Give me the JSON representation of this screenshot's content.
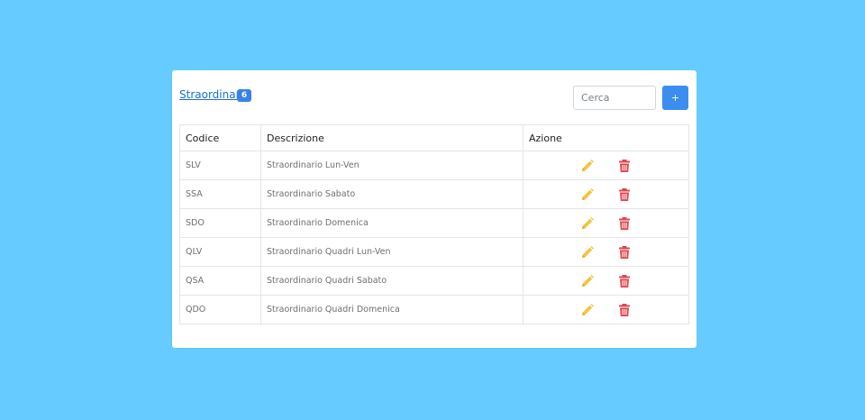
{
  "panel": {
    "title": "Straordinari",
    "count": "6"
  },
  "search": {
    "placeholder": "Cerca",
    "value": ""
  },
  "add_button": {
    "label": "+"
  },
  "table": {
    "headers": {
      "code": "Codice",
      "description": "Descrizione",
      "actions": "Azione"
    },
    "rows": [
      {
        "code": "SLV",
        "description": "Straordinario Lun-Ven"
      },
      {
        "code": "SSA",
        "description": "Straordinario Sabato"
      },
      {
        "code": "SDO",
        "description": "Straordinario Domenica"
      },
      {
        "code": "QLV",
        "description": "Straordinario Quadri Lun-Ven"
      },
      {
        "code": "QSA",
        "description": "Straordinario Quadri Sabato"
      },
      {
        "code": "QDO",
        "description": "Straordinario Quadri Domenica"
      }
    ]
  },
  "icons": {
    "edit": "pencil-icon",
    "delete": "trash-icon"
  },
  "colors": {
    "background": "#66ccff",
    "primary": "#3b8ef0",
    "link": "#1a6fd8",
    "edit": "#f5c33b",
    "delete": "#e0454f"
  }
}
